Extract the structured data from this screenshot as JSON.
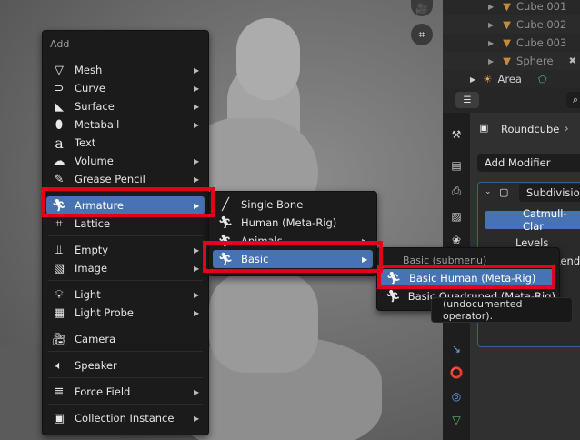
{
  "add_menu": {
    "title": "Add",
    "items": [
      {
        "label": "Mesh",
        "icon": "mesh-icon",
        "submenu": true
      },
      {
        "label": "Curve",
        "icon": "curve-icon",
        "submenu": true
      },
      {
        "label": "Surface",
        "icon": "surface-icon",
        "submenu": true
      },
      {
        "label": "Metaball",
        "icon": "metaball-icon",
        "submenu": true
      },
      {
        "label": "Text",
        "icon": "text-icon",
        "submenu": false
      },
      {
        "label": "Volume",
        "icon": "volume-icon",
        "submenu": true
      },
      {
        "label": "Grease Pencil",
        "icon": "grease-pencil-icon",
        "submenu": true
      },
      {
        "label": "Armature",
        "icon": "armature-icon",
        "submenu": true,
        "active": true
      },
      {
        "label": "Lattice",
        "icon": "lattice-icon",
        "submenu": false
      },
      {
        "label": "Empty",
        "icon": "empty-icon",
        "submenu": true
      },
      {
        "label": "Image",
        "icon": "image-icon",
        "submenu": true
      },
      {
        "label": "Light",
        "icon": "light-icon",
        "submenu": true
      },
      {
        "label": "Light Probe",
        "icon": "light-probe-icon",
        "submenu": true
      },
      {
        "label": "Camera",
        "icon": "camera-icon",
        "submenu": false
      },
      {
        "label": "Speaker",
        "icon": "speaker-icon",
        "submenu": false
      },
      {
        "label": "Force Field",
        "icon": "force-field-icon",
        "submenu": true
      },
      {
        "label": "Collection Instance",
        "icon": "collection-instance-icon",
        "submenu": true
      }
    ]
  },
  "armature_menu": {
    "items": [
      {
        "label": "Single Bone",
        "icon": "bone-icon",
        "submenu": false
      },
      {
        "label": "Human (Meta-Rig)",
        "icon": "armature-icon",
        "submenu": false
      },
      {
        "label": "Animals",
        "icon": "armature-icon",
        "submenu": true
      },
      {
        "label": "Basic",
        "icon": "armature-icon",
        "submenu": true,
        "active": true
      }
    ]
  },
  "basic_menu": {
    "title": "Basic (submenu)",
    "items": [
      {
        "label": "Basic Human (Meta-Rig)",
        "icon": "armature-icon",
        "active": true
      },
      {
        "label": "Basic Quadruped (Meta-Rig)",
        "icon": "armature-icon"
      }
    ]
  },
  "tooltip": {
    "text": "(undocumented operator)."
  },
  "outliner": {
    "rows": [
      {
        "label": "Cube.001",
        "icon": "mesh-triangle-icon"
      },
      {
        "label": "Cube.002",
        "icon": "mesh-triangle-icon"
      },
      {
        "label": "Cube.003",
        "icon": "mesh-triangle-icon"
      },
      {
        "label": "Sphere",
        "icon": "mesh-triangle-icon"
      },
      {
        "label": "Area",
        "icon": "light-icon"
      }
    ]
  },
  "properties": {
    "object_name": "Roundcube",
    "add_modifier": "Add Modifier",
    "modifier_name": "Subdivision",
    "catmull_clark": "Catmull-Clar",
    "levels_viewport": "Levels Viewpo",
    "render": "Rende"
  },
  "colors": {
    "highlight": "#4772b3",
    "annotation": "#e3001b"
  }
}
